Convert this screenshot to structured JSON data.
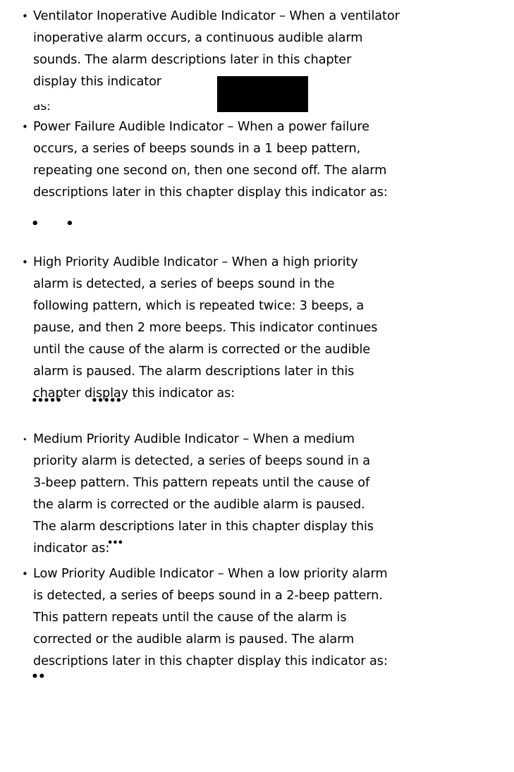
{
  "bullet_symbol": "•",
  "items": [
    {
      "text": "Ventilator Inoperative Audible Indicator – When a ventilator\ninoperative alarm occurs, a continuous audible alarm\nsounds. The alarm descriptions later in this chapter\ndisplay this indicator",
      "cutoff_text": "as:"
    },
    {
      "text": "Power Failure Audible Indicator – When a power failure\noccurs, a series of beeps sounds in a 1 beep pattern,\nrepeating one second on, then one second off. The alarm\ndescriptions later in this chapter display this indicator as:",
      "indicator": "•      •"
    },
    {
      "text": "High Priority Audible Indicator – When a high priority\nalarm is detected, a series of beeps sound in the\nfollowing pattern, which is repeated twice: 3 beeps, a\npause, and then 2 more beeps. This indicator continues\nuntil the cause of the alarm is corrected or the audible\nalarm is paused. The alarm descriptions later in this\nchapter display this indicator as:",
      "indicator": "•••••          •••••"
    },
    {
      "text": "Medium Priority Audible Indicator – When a medium\npriority alarm is detected, a series of beeps sound in a\n3-beep pattern. This pattern repeats until the cause of\nthe alarm is corrected or the audible alarm is paused.\nThe alarm descriptions later in this chapter display this\nindicator as:",
      "indicator": "•••"
    },
    {
      "text": "Low Priority Audible Indicator – When a low priority alarm\nis detected, a series of beeps sound in a 2-beep pattern.\nThis pattern repeats until the cause of the alarm is\ncorrected or the audible alarm is paused. The alarm\ndescriptions later in this chapter display this indicator as:",
      "indicator": "••"
    }
  ]
}
